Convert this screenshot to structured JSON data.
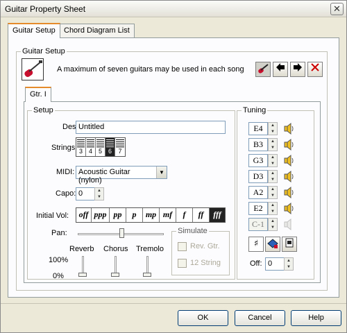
{
  "window": {
    "title": "Guitar Property Sheet",
    "close_glyph": "✕"
  },
  "tabs": [
    {
      "label": "Guitar Setup",
      "active": true
    },
    {
      "label": "Chord Diagram List",
      "active": false
    }
  ],
  "guitar_setup": {
    "group_label": "Guitar Setup",
    "info_text": "A maximum of seven guitars may be used in each song",
    "toolbar_icons": [
      "guitar-properties-icon",
      "arrow-left-icon",
      "arrow-right-icon",
      "delete-icon"
    ]
  },
  "guitar_tab": {
    "label": "Gtr. I"
  },
  "setup": {
    "group_label": "Setup",
    "desc_label": "Desc.:",
    "desc_value": "Untitled",
    "strings_label": "Strings:",
    "strings_options": [
      "3",
      "4",
      "5",
      "6",
      "7"
    ],
    "strings_selected": "6",
    "midi_label": "MIDI:",
    "midi_value": "Acoustic Guitar (nylon)",
    "capo_label": "Capo:",
    "capo_value": "0",
    "initial_vol_label": "Initial Vol:",
    "vol_options": [
      "off",
      "ppp",
      "pp",
      "p",
      "mp",
      "mf",
      "f",
      "ff",
      "fff"
    ],
    "vol_selected": "fff",
    "pan_label": "Pan:",
    "reverb_label": "Reverb",
    "chorus_label": "Chorus",
    "tremolo_label": "Tremolo",
    "pct_100": "100%",
    "pct_0": "0%"
  },
  "simulate": {
    "group_label": "Simulate",
    "rev_gtr_label": "Rev. Gtr.",
    "twelve_string_label": "12 String"
  },
  "tuning": {
    "group_label": "Tuning",
    "notes": [
      "E4",
      "B3",
      "G3",
      "D3",
      "A2",
      "E2",
      "C-1"
    ],
    "off_label": "Off:",
    "off_value": "0",
    "sharp_glyph": "♯"
  },
  "footer": {
    "ok_label": "OK",
    "cancel_label": "Cancel",
    "help_label": "Help"
  },
  "colors": {
    "accent_tab": "#e68b2c",
    "guitar_red": "#c8102e",
    "delete_red": "#cc0000"
  }
}
